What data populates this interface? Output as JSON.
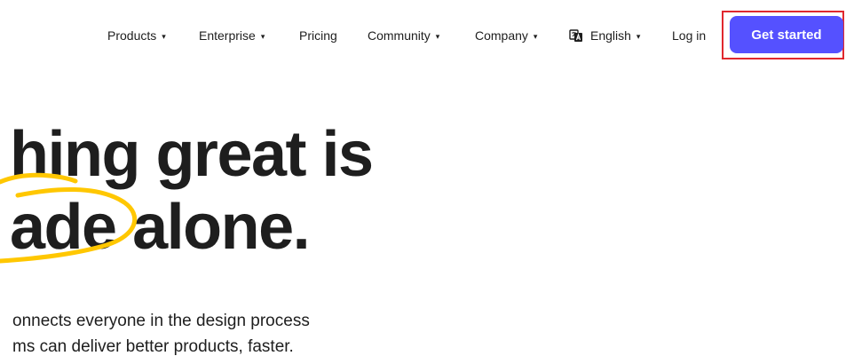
{
  "nav": {
    "items": [
      {
        "label": "Products",
        "has_dropdown": true
      },
      {
        "label": "Enterprise",
        "has_dropdown": true
      },
      {
        "label": "Pricing",
        "has_dropdown": false
      },
      {
        "label": "Community",
        "has_dropdown": true
      },
      {
        "label": "Company",
        "has_dropdown": true
      }
    ],
    "language": {
      "label": "English",
      "icon": "language-icon"
    },
    "login_label": "Log in",
    "cta_label": "Get started",
    "dropdown_glyph": "▾"
  },
  "hero": {
    "headline_line1": "hing great is",
    "headline_line2": "ade alone.",
    "subtext_line1": "onnects everyone in the design process",
    "subtext_line2": "ms can deliver better products, faster."
  },
  "colors": {
    "accent": "#5551ff",
    "highlight_border": "#e0282e",
    "scribble": "#ffc700",
    "text": "#1e1e1e"
  }
}
